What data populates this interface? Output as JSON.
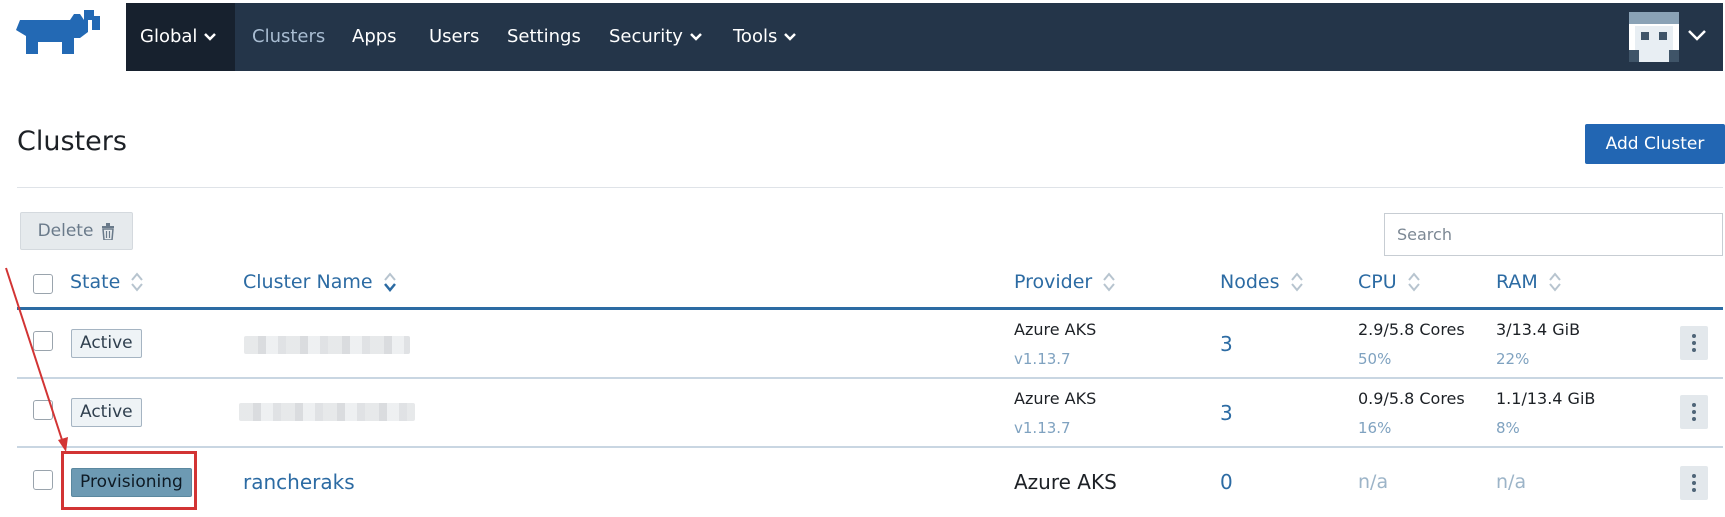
{
  "header": {
    "nav": {
      "global": "Global",
      "clusters": "Clusters",
      "apps": "Apps",
      "users": "Users",
      "settings": "Settings",
      "security": "Security",
      "tools": "Tools"
    }
  },
  "page": {
    "title": "Clusters",
    "add_cluster_label": "Add Cluster",
    "delete_label": "Delete",
    "search_placeholder": "Search"
  },
  "table": {
    "columns": {
      "state": "State",
      "cluster_name": "Cluster Name",
      "provider": "Provider",
      "nodes": "Nodes",
      "cpu": "CPU",
      "ram": "RAM"
    },
    "rows": [
      {
        "state": "Active",
        "provider": "Azure AKS",
        "version": "v1.13.7",
        "nodes": "3",
        "cpu": "2.9/5.8 Cores",
        "cpu_pct": "50%",
        "ram": "3/13.4 GiB",
        "ram_pct": "22%"
      },
      {
        "state": "Active",
        "provider": "Azure AKS",
        "version": "v1.13.7",
        "nodes": "3",
        "cpu": "0.9/5.8 Cores",
        "cpu_pct": "16%",
        "ram": "1.1/13.4 GiB",
        "ram_pct": "8%"
      },
      {
        "state": "Provisioning",
        "name": "rancheraks",
        "provider": "Azure AKS",
        "nodes": "0",
        "cpu": "n/a",
        "ram": "n/a"
      }
    ]
  },
  "colors": {
    "navbar": "#243549",
    "nav_active": "#17212e",
    "primary": "#2266b3",
    "link": "#2c6ba3",
    "annotation": "#d23434"
  },
  "icons": [
    "rancher-logo-icon",
    "chevron-down-icon",
    "trash-icon",
    "sort-icon",
    "kebab-menu-icon",
    "avatar-icon"
  ]
}
